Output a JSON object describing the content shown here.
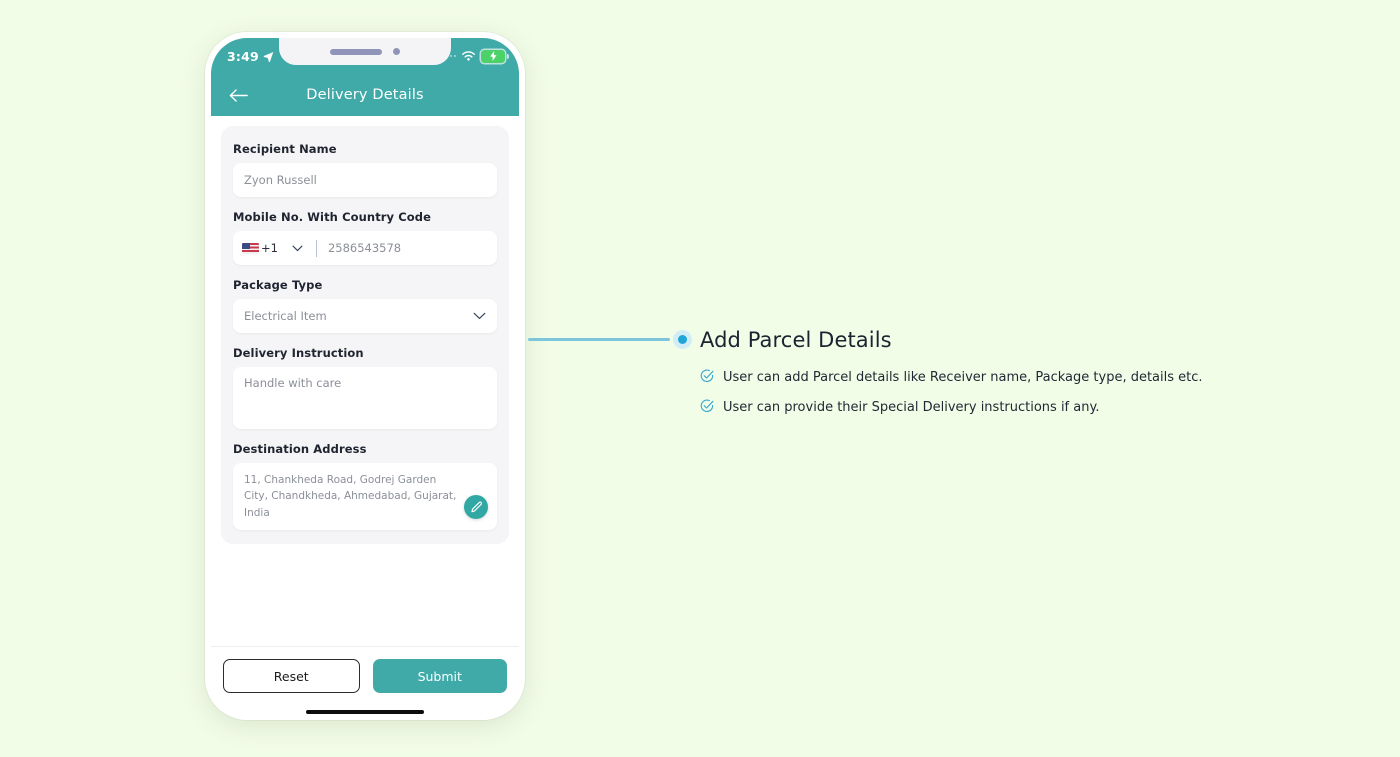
{
  "phone": {
    "status_bar": {
      "time": "3:49",
      "location_icon": "location-arrow-icon",
      "wifi_icon": "wifi-icon",
      "battery_icon": "battery-charging-icon"
    },
    "app_bar": {
      "back_icon": "back-arrow-icon",
      "title": "Delivery Details"
    },
    "form": {
      "fields": [
        {
          "label": "Recipient Name",
          "value": "Zyon Russell"
        },
        {
          "label": "Mobile No. With Country Code",
          "country_code": "+1",
          "flag": "us-flag-icon",
          "chevron": "chevron-down-icon",
          "value": "2586543578"
        },
        {
          "label": "Package Type",
          "value": "Electrical Item",
          "chevron": "chevron-down-icon"
        },
        {
          "label": "Delivery Instruction",
          "value": "Handle with care"
        },
        {
          "label": "Destination Address",
          "value": "11, Chankheda Road, Godrej Garden City, Chandkheda, Ahmedabad, Gujarat, India",
          "edit_icon": "edit-pencil-icon"
        }
      ]
    },
    "footer": {
      "reset_label": "Reset",
      "submit_label": "Submit"
    }
  },
  "annotation": {
    "title": "Add Parcel Details",
    "bullets": [
      "User can add Parcel details like Receiver name, Package type, details etc.",
      "User can provide their Special Delivery instructions if any."
    ]
  },
  "colors": {
    "page_background": "#f2fde8",
    "teal": "#40aaa8",
    "accent_blue": "#21a6d8",
    "connector_blue": "#7cc5dd",
    "card_gray": "#f5f5f7"
  }
}
